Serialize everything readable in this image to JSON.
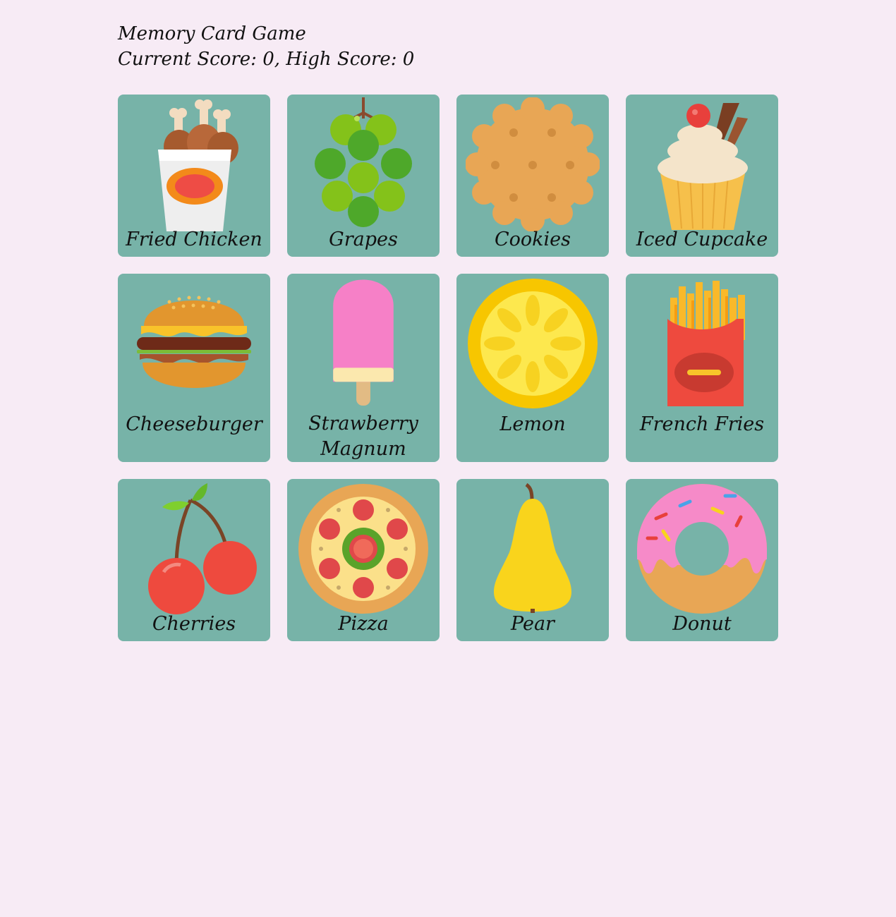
{
  "game": {
    "title": "Memory Card Game",
    "score_line": "Current Score: 0, High Score: 0"
  },
  "cards": [
    {
      "label": "Fried Chicken",
      "icon": "fried-chicken-icon"
    },
    {
      "label": "Grapes",
      "icon": "grapes-icon"
    },
    {
      "label": "Cookies",
      "icon": "cookie-icon"
    },
    {
      "label": "Iced Cupcake",
      "icon": "cupcake-icon"
    },
    {
      "label": "Cheeseburger",
      "icon": "cheeseburger-icon"
    },
    {
      "label": "Strawberry Magnum",
      "icon": "popsicle-icon"
    },
    {
      "label": "Lemon",
      "icon": "lemon-icon"
    },
    {
      "label": "French Fries",
      "icon": "french-fries-icon"
    },
    {
      "label": "Cherries",
      "icon": "cherries-icon"
    },
    {
      "label": "Pizza",
      "icon": "pizza-icon"
    },
    {
      "label": "Pear",
      "icon": "pear-icon"
    },
    {
      "label": "Donut",
      "icon": "donut-icon"
    }
  ],
  "colors": {
    "background": "#f7ebf5",
    "card": "#77b3a8"
  }
}
